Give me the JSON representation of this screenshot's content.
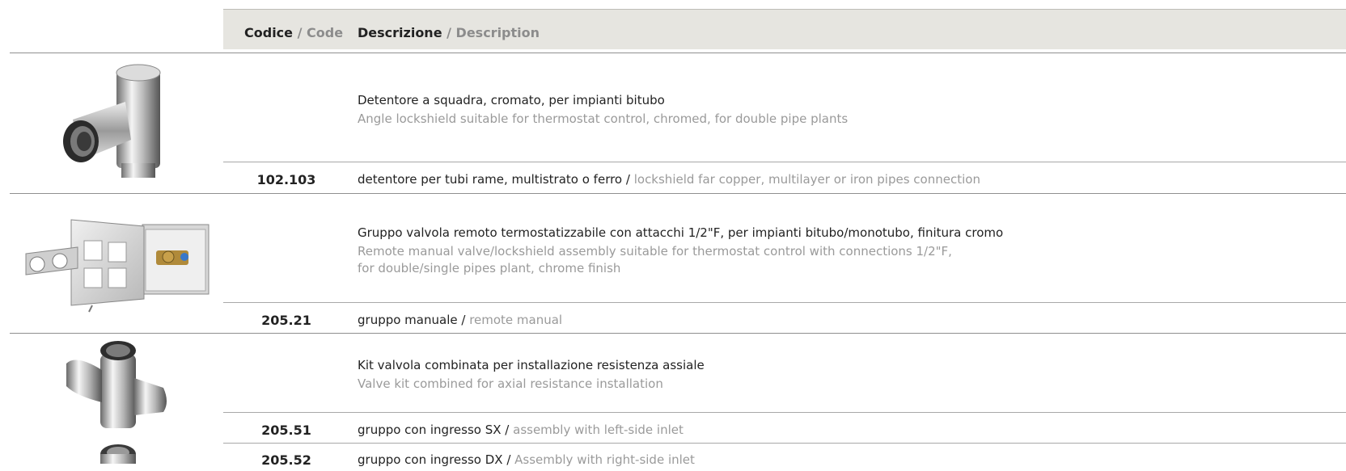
{
  "header": {
    "code_it": "Codice",
    "code_sep": " / ",
    "code_en": "Code",
    "desc_it": "Descrizione",
    "desc_sep": " / ",
    "desc_en": "Description"
  },
  "sections": [
    {
      "image": "angle-lockshield-valve-icon",
      "title_it": "Detentore a squadra, cromato, per impianti bitubo",
      "title_en": "Angle lockshield suitable for thermostat control, chromed, for double pipe plants",
      "title_en_2": "",
      "rows": [
        {
          "code": "102.103",
          "desc_it": "detentore per tubi rame, multistrato o ferro",
          "sep": " / ",
          "desc_en": "lockshield far copper, multilayer or iron pipes connection"
        }
      ]
    },
    {
      "image": "remote-valve-box-icon",
      "title_it": "Gruppo valvola remoto termostatizzabile con attacchi 1/2\"F, per impianti bitubo/monotubo, finitura cromo",
      "title_en": "Remote manual valve/lockshield assembly suitable for thermostat control with connections 1/2\"F,",
      "title_en_2": "for double/single pipes plant, chrome finish",
      "rows": [
        {
          "code": "205.21",
          "desc_it": "gruppo manuale",
          "sep": " / ",
          "desc_en": "remote manual"
        }
      ]
    },
    {
      "image": "combined-valve-kit-icon",
      "title_it": "Kit valvola combinata per installazione resistenza assiale",
      "title_en": "Valve kit combined for axial resistance installation",
      "title_en_2": "",
      "rows": [
        {
          "code": "205.51",
          "desc_it": "gruppo con ingresso SX",
          "sep": " / ",
          "desc_en": "assembly with left-side inlet"
        },
        {
          "code": "205.52",
          "desc_it": "gruppo con ingresso DX",
          "sep": " / ",
          "desc_en": "Assembly with right-side inlet"
        }
      ]
    }
  ]
}
